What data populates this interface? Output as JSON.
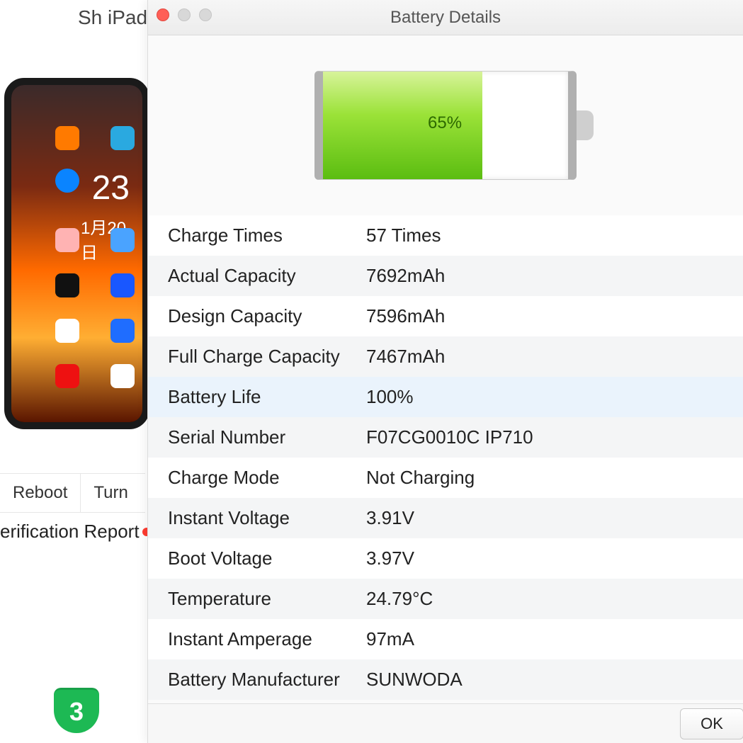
{
  "bg": {
    "titleFragment": "Sh iPad",
    "deviceTime": "23",
    "deviceDate": "1月20日",
    "reboot": "Reboot",
    "turn": "Turn",
    "reportLabel": "erification Report",
    "logoText": "3"
  },
  "modal": {
    "title": "Battery Details",
    "battery": {
      "percentLabel": "65%",
      "percentValue": 65
    },
    "rows": [
      {
        "label": "Charge Times",
        "value": "57 Times"
      },
      {
        "label": "Actual Capacity",
        "value": "7692mAh"
      },
      {
        "label": "Design Capacity",
        "value": "7596mAh"
      },
      {
        "label": "Full Charge Capacity",
        "value": "7467mAh"
      },
      {
        "label": "Battery Life",
        "value": "100%",
        "highlight": true
      },
      {
        "label": "Serial Number",
        "value": "F07CG0010C    IP710"
      },
      {
        "label": "Charge Mode",
        "value": "Not Charging"
      },
      {
        "label": "Instant Voltage",
        "value": "3.91V"
      },
      {
        "label": "Boot Voltage",
        "value": "3.97V"
      },
      {
        "label": "Temperature",
        "value": "24.79°C"
      },
      {
        "label": "Instant Amperage",
        "value": "97mA"
      },
      {
        "label": "Battery Manufacturer",
        "value": "SUNWODA"
      }
    ],
    "okLabel": "OK"
  }
}
